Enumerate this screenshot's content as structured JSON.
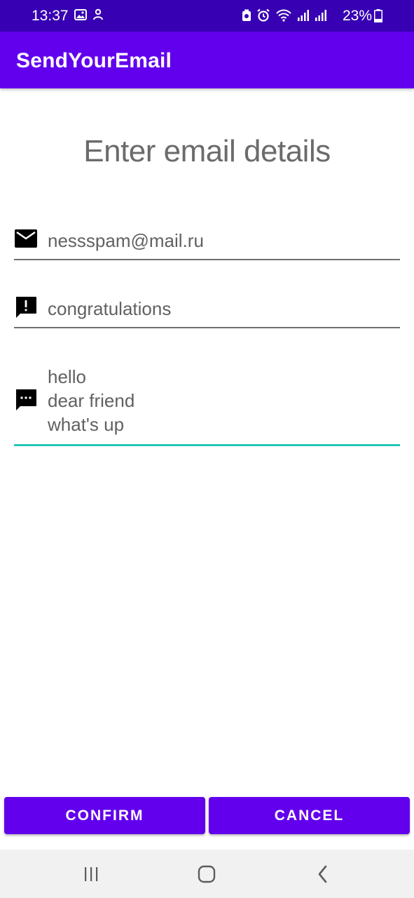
{
  "status_bar": {
    "time": "13:37",
    "battery_percent": "23%",
    "battery_level": 0.23,
    "left_icons": [
      "image-icon",
      "notification-person-icon"
    ],
    "right_icons": [
      "battery-saver-icon",
      "alarm-icon",
      "wifi-icon",
      "signal-icon",
      "signal-icon"
    ]
  },
  "app_bar": {
    "title": "SendYourEmail",
    "color": "#6200ee"
  },
  "main": {
    "heading": "Enter email details",
    "fields": {
      "email": {
        "value": "nessspam@mail.ru",
        "icon": "email-icon"
      },
      "subject": {
        "value": "congratulations",
        "icon": "feedback-icon"
      },
      "message": {
        "value": "hello\ndear friend\nwhat's up",
        "icon": "message-icon",
        "focused": true
      }
    }
  },
  "buttons": {
    "confirm": "CONFIRM",
    "cancel": "CANCEL"
  },
  "nav_bar": {
    "items": [
      "recents-icon",
      "home-icon",
      "back-icon"
    ]
  },
  "colors": {
    "status_bar": "#3700b3",
    "primary": "#6200ee",
    "focus_accent": "#26c6b8"
  }
}
